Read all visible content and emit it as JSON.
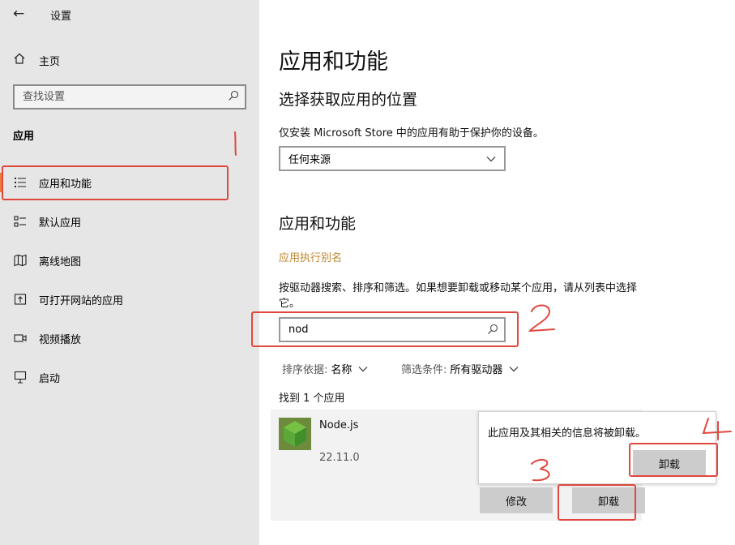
{
  "window": {
    "title": "设置"
  },
  "sidebar": {
    "home_label": "主页",
    "search_placeholder": "查找设置",
    "section_title": "应用",
    "items": [
      {
        "label": "应用和功能",
        "icon": "apps-features-icon",
        "active": true
      },
      {
        "label": "默认应用",
        "icon": "default-apps-icon"
      },
      {
        "label": "离线地图",
        "icon": "offline-maps-icon"
      },
      {
        "label": "可打开网站的应用",
        "icon": "apps-for-websites-icon"
      },
      {
        "label": "视频播放",
        "icon": "video-playback-icon"
      },
      {
        "label": "启动",
        "icon": "startup-icon"
      }
    ]
  },
  "main": {
    "page_title": "应用和功能",
    "choose_heading": "选择获取应用的位置",
    "choose_desc": "仅安装 Microsoft Store 中的应用有助于保护你的设备。",
    "source_value": "任何来源",
    "apps_heading": "应用和功能",
    "alias_link": "应用执行别名",
    "search_desc": "按驱动器搜索、排序和筛选。如果想要卸载或移动某个应用，请从列表中选择它。",
    "filter_value": "nod",
    "sort_label": "排序依据:",
    "sort_value": "名称",
    "filter_label": "筛选条件:",
    "filter_drive": "所有驱动器",
    "found_text": "找到 1 个应用",
    "app": {
      "name": "Node.js",
      "version": "22.11.0"
    },
    "modify_button": "修改",
    "uninstall_button": "卸载",
    "flyout": {
      "message": "此应用及其相关的信息将被卸载。",
      "confirm_button": "卸载"
    }
  },
  "annotations": [
    "1",
    "2",
    "3",
    "4"
  ],
  "colors": {
    "accent": "#e8803a",
    "annotation_red": "#e0483e",
    "link": "#c0862a"
  }
}
